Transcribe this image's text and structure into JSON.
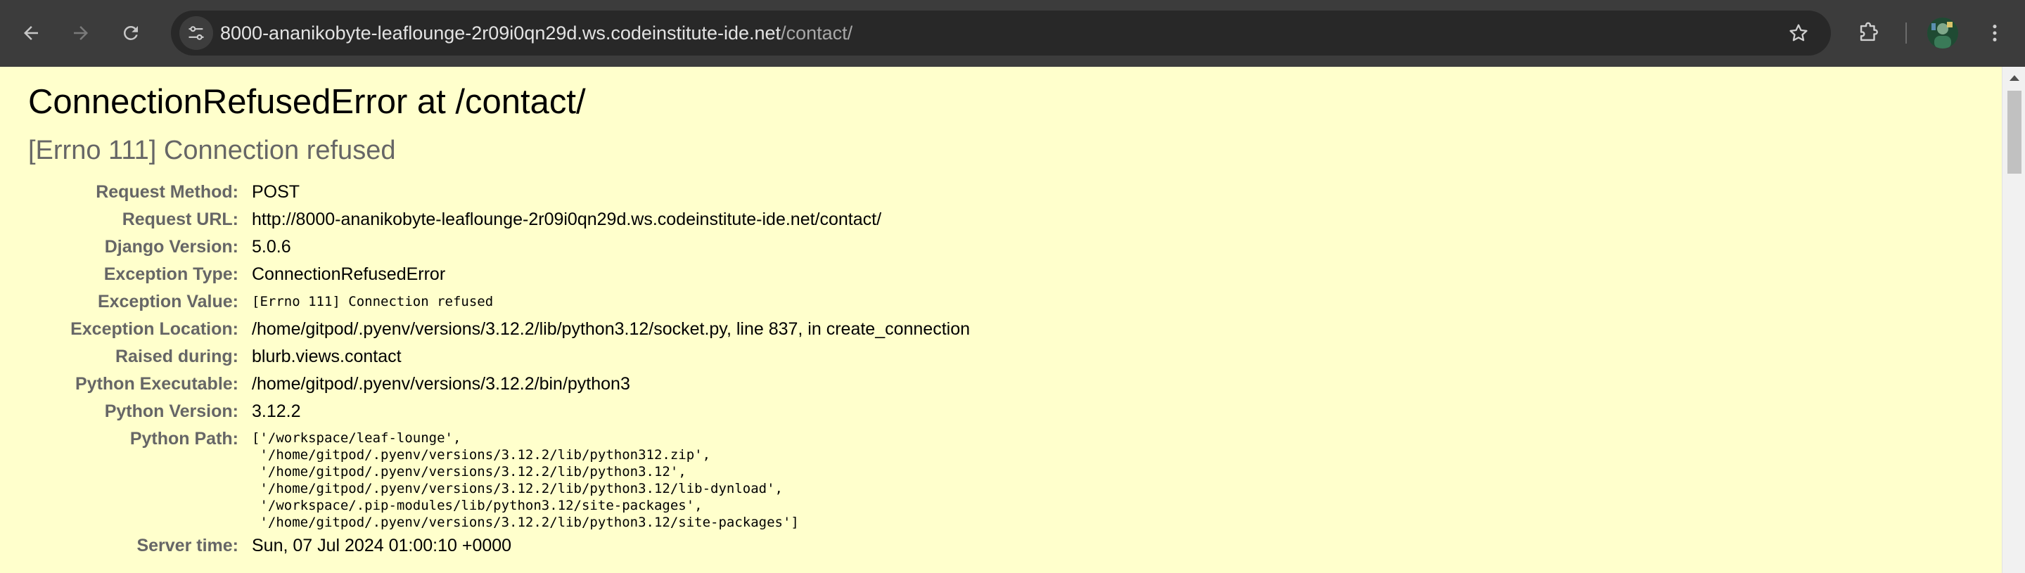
{
  "browser": {
    "url_host": "8000-ananikobyte-leaflounge-2r09i0qn29d.ws.codeinstitute-ide.net",
    "url_path": "/contact/",
    "icons": {
      "back": "arrow-left-icon",
      "forward": "arrow-right-icon",
      "reload": "reload-icon",
      "site_info": "tune-icon",
      "bookmark": "star-icon",
      "extensions": "puzzle-icon",
      "menu": "kebab-menu-icon"
    }
  },
  "error": {
    "title": "ConnectionRefusedError at /contact/",
    "subtitle": "[Errno 111] Connection refused"
  },
  "details": [
    {
      "label": "Request Method:",
      "value": "POST"
    },
    {
      "label": "Request URL:",
      "value": "http://8000-ananikobyte-leaflounge-2r09i0qn29d.ws.codeinstitute-ide.net/contact/"
    },
    {
      "label": "Django Version:",
      "value": "5.0.6"
    },
    {
      "label": "Exception Type:",
      "value": "ConnectionRefusedError"
    },
    {
      "label": "Exception Value:",
      "value": "[Errno 111] Connection refused"
    },
    {
      "label": "Exception Location:",
      "value": "/home/gitpod/.pyenv/versions/3.12.2/lib/python3.12/socket.py, line 837, in create_connection"
    },
    {
      "label": "Raised during:",
      "value": "blurb.views.contact"
    },
    {
      "label": "Python Executable:",
      "value": "/home/gitpod/.pyenv/versions/3.12.2/bin/python3"
    },
    {
      "label": "Python Version:",
      "value": "3.12.2"
    },
    {
      "label": "Python Path:",
      "value": "['/workspace/leaf-lounge',\n '/home/gitpod/.pyenv/versions/3.12.2/lib/python312.zip',\n '/home/gitpod/.pyenv/versions/3.12.2/lib/python3.12',\n '/home/gitpod/.pyenv/versions/3.12.2/lib/python3.12/lib-dynload',\n '/workspace/.pip-modules/lib/python3.12/site-packages',\n '/home/gitpod/.pyenv/versions/3.12.2/lib/python3.12/site-packages']"
    },
    {
      "label": "Server time:",
      "value": "Sun, 07 Jul 2024 01:00:10 +0000"
    }
  ],
  "colors": {
    "page_background": "#ffffcc",
    "toolbar_background": "#3c3c3c",
    "label_gray": "#666666"
  }
}
